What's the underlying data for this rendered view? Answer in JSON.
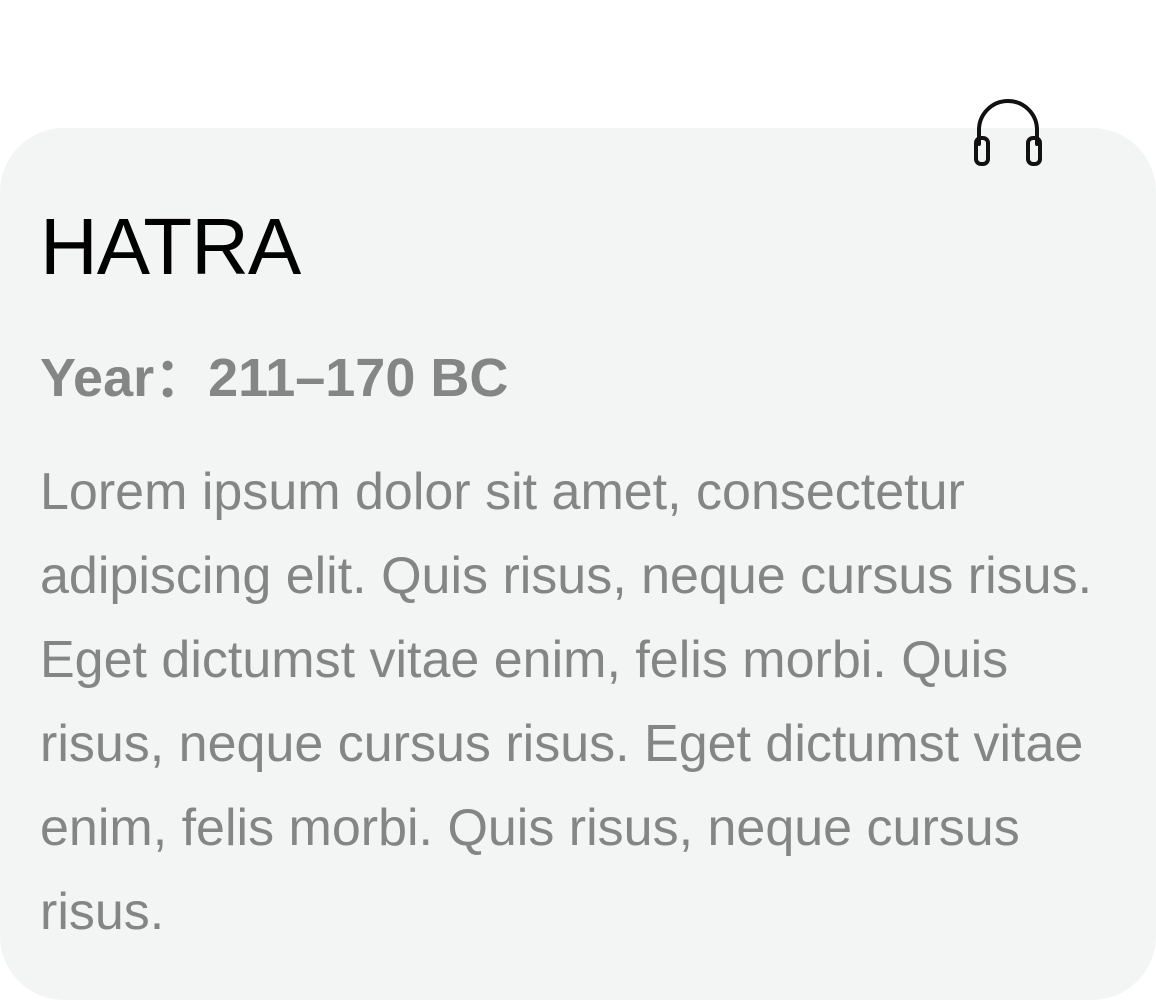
{
  "card": {
    "title": "HATRA",
    "year_text": "Year：211–170 BC",
    "description": "Lorem ipsum dolor sit amet, consectetur adipiscing elit. Quis risus, neque cursus risus. Eget dictumst vitae enim, felis morbi. Quis risus, neque cursus risus. Eget dictumst vitae enim, felis morbi. Quis risus, neque cursus risus.",
    "audio_icon": "headphones-icon"
  },
  "colors": {
    "card_background": "#f3f4f4",
    "title": "#000000",
    "secondary_text": "#848585"
  }
}
